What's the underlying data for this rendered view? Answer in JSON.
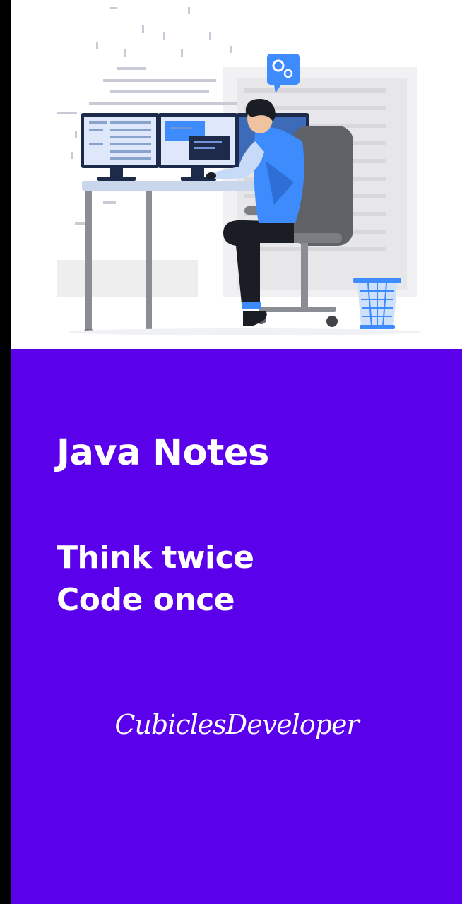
{
  "splash": {
    "title": "Java Notes",
    "tagline_line1": "Think twice",
    "tagline_line2": "Code once",
    "brand": "CubiclesDeveloper"
  },
  "illustration": {
    "subject": "developer-at-desk-illustration",
    "icons": [
      "gear-icon"
    ]
  },
  "colors": {
    "panel": "#5a00ea",
    "accent_blue": "#3d8bfd",
    "text": "#ffffff"
  }
}
